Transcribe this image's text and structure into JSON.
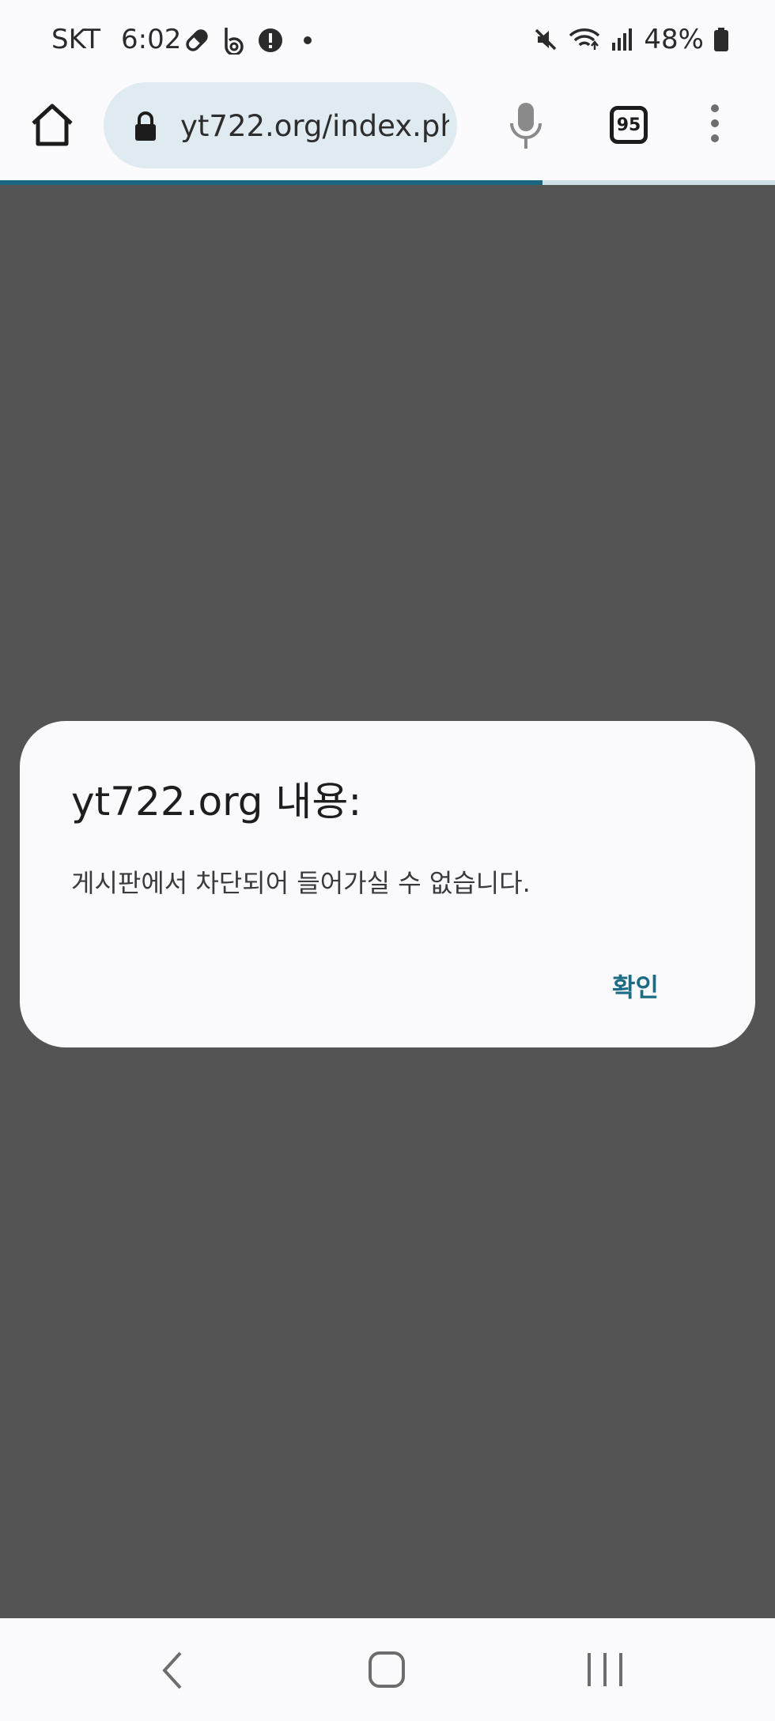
{
  "status_bar": {
    "carrier": "SKT",
    "time": "6:02",
    "battery": "48%",
    "icons_left": [
      "pill-icon",
      "b-app-icon",
      "alert-icon",
      "dot-icon"
    ],
    "icons_right": [
      "mute-icon",
      "wifi-icon",
      "signal-icon",
      "battery-icon"
    ]
  },
  "browser": {
    "url": "yt722.org/index.ph",
    "tab_count": "95",
    "load_progress": 0.7
  },
  "dialog": {
    "title": "yt722.org 내용:",
    "message": "게시판에서 차단되어 들어가실 수 없습니다.",
    "ok_label": "확인"
  },
  "colors": {
    "accent": "#1b6b84",
    "overlay": "#545454",
    "url_pill": "#dfeaf1"
  },
  "nav_bar": {
    "icons": [
      "back-icon",
      "home-icon",
      "recents-icon"
    ]
  }
}
